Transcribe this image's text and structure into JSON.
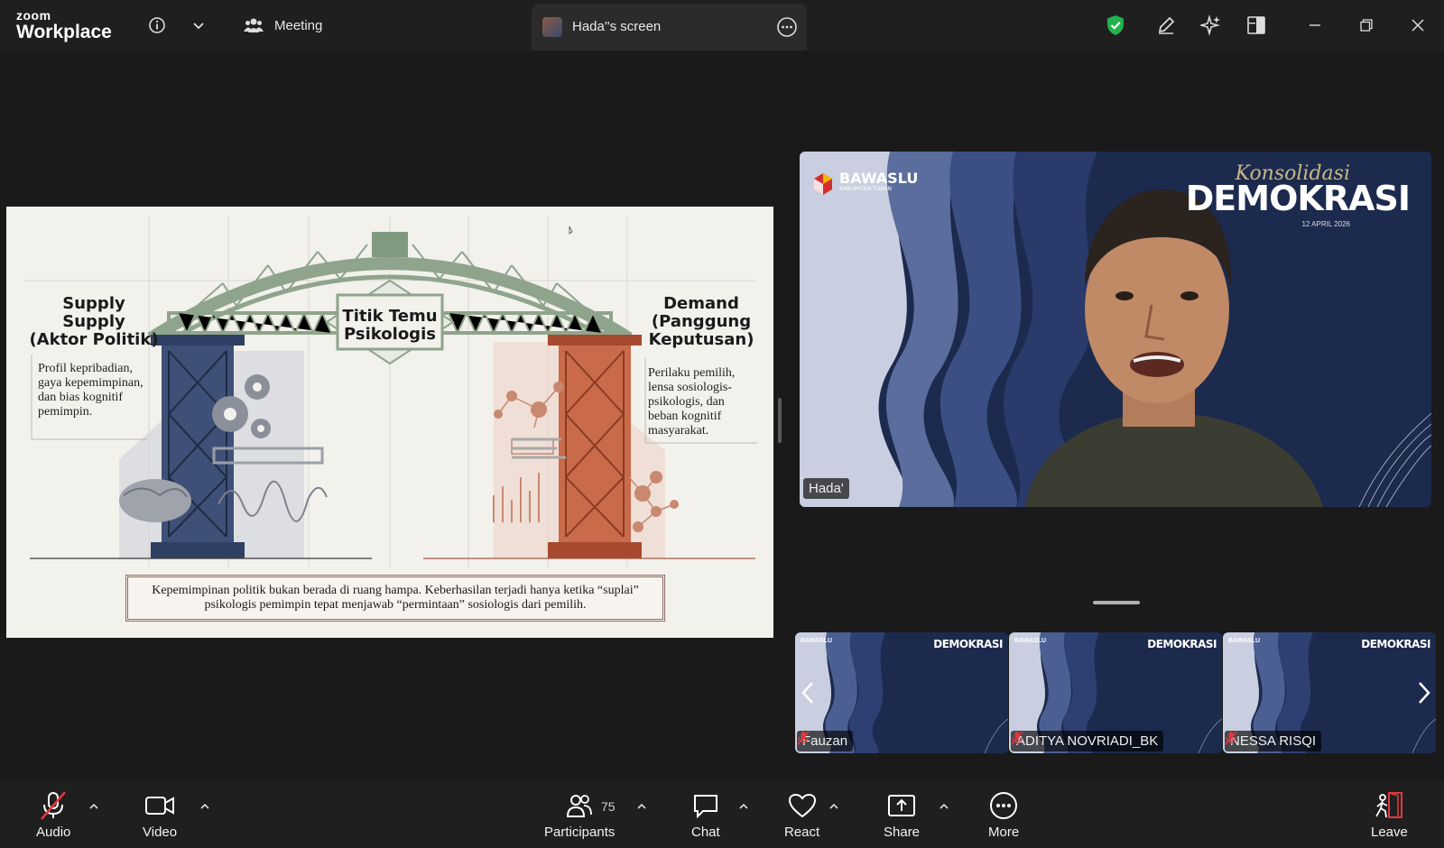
{
  "topbar": {
    "brand_small": "zoom",
    "brand_big": "Workplace",
    "meeting_label": "Meeting",
    "screen_tab_title": "Hada''s screen"
  },
  "slide": {
    "supply_title": "Supply\nSupply\n(Aktor Politik)",
    "supply_desc": "Profil kepribadian, gaya kepemimpinan, dan bias kognitif pemimpin.",
    "center_title": "Titik Temu Psikologis",
    "demand_title": "Demand\n(Panggung\nKeputusan)",
    "demand_desc": "Perilaku pemilih, lensa sosiologis-psikologis, dan beban kognitif masyarakat.",
    "banner": "Kepemimpinan politik bukan berada di ruang hampa. Keberhasilan terjadi hanya ketika “suplai” psikologis pemimpin tepat menjawab “permintaan” sosiologis dari pemilih."
  },
  "speaker": {
    "name": "Hada'",
    "logo_text": "BAWASLU",
    "logo_sub": "KABUPATEN TUBAN",
    "event_script": "Konsolidasi",
    "event_title": "DEMOKRASI",
    "event_date": "12 APRIL 2026"
  },
  "thumbnails": [
    {
      "name": "Fauzan",
      "muted": true
    },
    {
      "name": "ADITYA NOVRIADI_BK",
      "muted": true
    },
    {
      "name": "NESSA RISQI",
      "muted": true
    }
  ],
  "toolbar": {
    "audio": "Audio",
    "video": "Video",
    "participants": "Participants",
    "participants_count": "75",
    "chat": "Chat",
    "react": "React",
    "share": "Share",
    "more": "More",
    "leave": "Leave"
  },
  "colors": {
    "shield_green": "#22b14c",
    "leave_red": "#e0383e",
    "mute_red": "#e0383e",
    "slide_blue": "#2f3f63",
    "slide_rust": "#b5573a",
    "slide_green": "#8fa48c"
  }
}
